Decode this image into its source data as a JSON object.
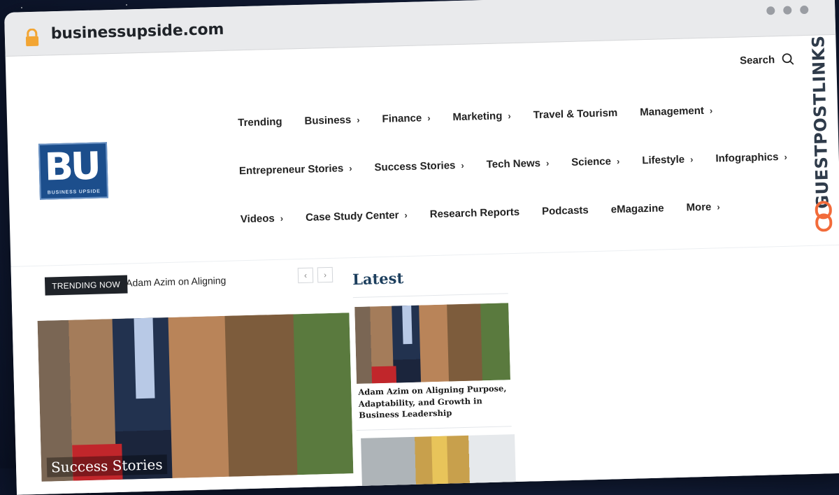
{
  "browser": {
    "url": "businessupside.com"
  },
  "header": {
    "search_label": "Search",
    "logo_text": "BU",
    "logo_subtext": "BUSINESS UPSIDE"
  },
  "nav": {
    "row1": [
      {
        "label": "Trending",
        "has_submenu": false
      },
      {
        "label": "Business",
        "has_submenu": true
      },
      {
        "label": "Finance",
        "has_submenu": true
      },
      {
        "label": "Marketing",
        "has_submenu": true
      },
      {
        "label": "Travel & Tourism",
        "has_submenu": false
      },
      {
        "label": "Management",
        "has_submenu": true
      }
    ],
    "row2": [
      {
        "label": "Entrepreneur Stories",
        "has_submenu": true
      },
      {
        "label": "Success Stories",
        "has_submenu": true
      },
      {
        "label": "Tech News",
        "has_submenu": true
      },
      {
        "label": "Science",
        "has_submenu": true
      },
      {
        "label": "Lifestyle",
        "has_submenu": true
      },
      {
        "label": "Infographics",
        "has_submenu": true
      }
    ],
    "row3": [
      {
        "label": "Videos",
        "has_submenu": true
      },
      {
        "label": "Case Study Center",
        "has_submenu": true
      },
      {
        "label": "Research Reports",
        "has_submenu": false
      },
      {
        "label": "Podcasts",
        "has_submenu": false
      },
      {
        "label": "eMagazine",
        "has_submenu": false
      },
      {
        "label": "More",
        "has_submenu": true
      }
    ]
  },
  "trending": {
    "badge": "TRENDING NOW",
    "headline": "Adam Azim on Aligning",
    "prev_icon": "chevron-left-icon",
    "next_icon": "chevron-right-icon"
  },
  "hero": {
    "category": "Success Stories"
  },
  "latest": {
    "title": "Latest",
    "cards": [
      {
        "title": "Adam Azim on Aligning Purpose, Adaptability, and Growth in Business Leadership"
      }
    ]
  },
  "watermark": {
    "text": "GUESTPOSTLINKS",
    "color": "#f26b3a"
  }
}
